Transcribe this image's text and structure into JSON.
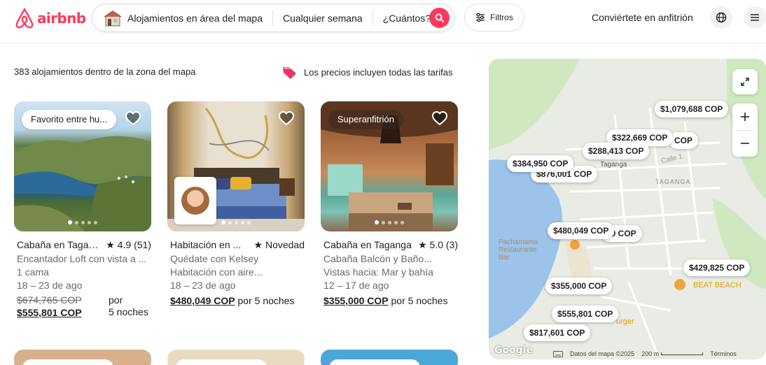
{
  "header": {
    "logo_text": "airbnb",
    "search": {
      "location": "Alojamientos en área del mapa",
      "week": "Cualquier semana",
      "guests": "¿Cuántos?"
    },
    "filters_label": "Filtros",
    "host_link": "Conviértete en anfitrión"
  },
  "subheader": {
    "count": "383 alojamientos dentro de la zona del mapa",
    "price_note": "Los precios incluyen todas las tarifas"
  },
  "listings": [
    {
      "badge": "Favorito entre hu...",
      "title": "Cabaña en Tagan...",
      "rating": "★ 4.9 (51)",
      "subtitle": "Encantador Loft con vista a ...",
      "detail": "1 cama",
      "dates": "18 – 23 de ago",
      "old_price": "$674,765 COP",
      "price": "$555,801 COP",
      "per_1": "por",
      "per_2": "5 noches"
    },
    {
      "title": "Habitación en ...",
      "rating": "★ Novedad",
      "subtitle": "Quédate con Kelsey",
      "detail": "Habitación con aire...",
      "dates": "18 – 23 de ago",
      "price": "$480,049 COP",
      "per": " por 5 noches"
    },
    {
      "badge": "Superanfitrión",
      "title": "Cabaña en Taganga",
      "rating": "★ 5.0 (3)",
      "subtitle": "Cabaña Balcón y Baño...",
      "detail": "Vistas hacia: Mar y bahía",
      "dates": "12 – 17 de ago",
      "price": "$355,000 COP",
      "per": " por 5 noches"
    }
  ],
  "map": {
    "pins": [
      "$1,079,688 COP",
      "$322,669 COP",
      "COP",
      "$288,413 COP",
      "$384,950 COP",
      "$876,001 COP",
      "$480,049 COP",
      "00 COP",
      "$429,825 COP",
      "$355,000 COP",
      "$555,801 COP",
      "$817,601 COP"
    ],
    "labels": {
      "taganga_town": "Taganga",
      "taganga_area": "TAGANGA",
      "street": "Calle 1",
      "restaurant": "Pachamama Restaurante Bar",
      "beach": "BEAT BEACH",
      "burger": "urger"
    },
    "footer": {
      "data": "Datos del mapa ©2025",
      "scale": "200 m",
      "terms": "Términos"
    },
    "google": "Google"
  }
}
